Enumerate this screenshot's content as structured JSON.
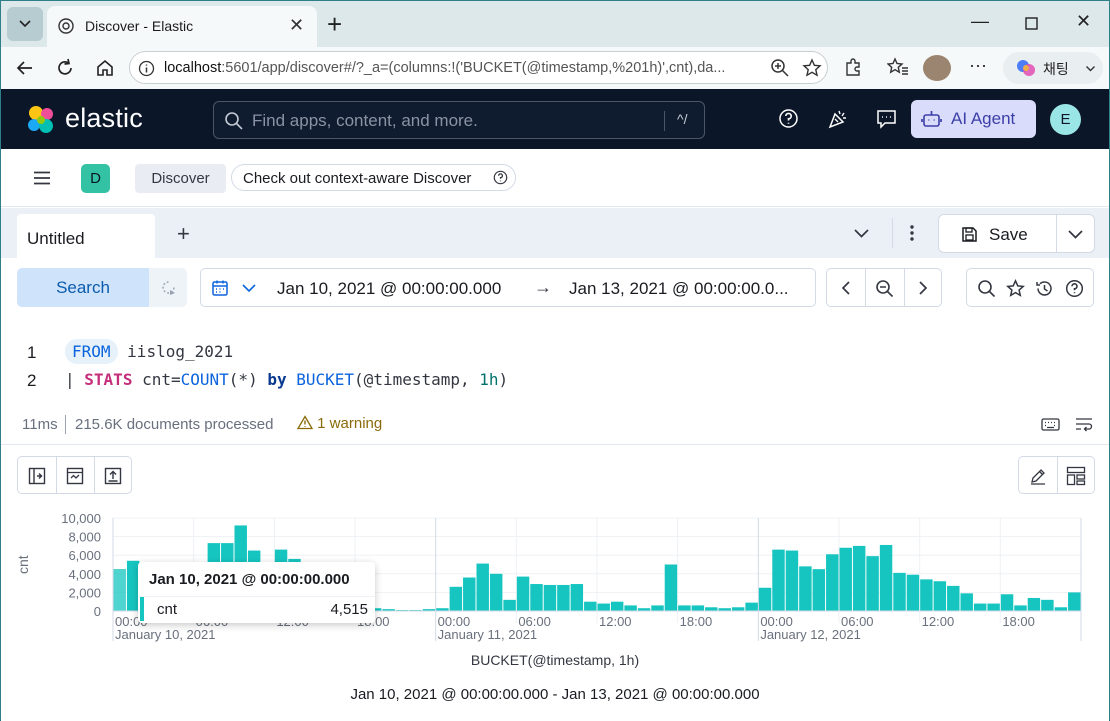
{
  "browser": {
    "tab_title": "Discover - Elastic",
    "url_host": "localhost",
    "url_rest": ":5601/app/discover#/?_a=(columns:!('BUCKET(@timestamp,%201h)',cnt),da...",
    "chat_label": "채팅"
  },
  "header": {
    "brand": "elastic",
    "search_placeholder": "Find apps, content, and more.",
    "search_shortcut": "^/",
    "ai_agent_label": "AI Agent",
    "avatar_initial": "E"
  },
  "breadcrumbs": {
    "space_initial": "D",
    "current": "Discover",
    "context_aware": "Check out context-aware Discover"
  },
  "tabs": {
    "active": "Untitled",
    "save_label": "Save"
  },
  "query_bar": {
    "search_label": "Search",
    "date_start": "Jan 10, 2021 @ 00:00:00.000",
    "date_end": "Jan 13, 2021 @ 00:00:00.0...",
    "arrow": "→"
  },
  "editor": {
    "line1_no": "1",
    "line2_no": "2",
    "from": "FROM",
    "index": "iislog_2021",
    "pipe": "|",
    "stats": "STATS",
    "assign": "cnt=",
    "count_fn": "COUNT",
    "count_arg": "(*)",
    "by": "by",
    "bucket_fn": "BUCKET",
    "bucket_arg": "(@timestamp, ",
    "bucket_interval": "1h",
    "close": ")"
  },
  "status": {
    "duration": "11ms",
    "docs": "215.6K documents processed",
    "warning": "1 warning"
  },
  "chart": {
    "ylabel": "cnt",
    "xlabel": "BUCKET(@timestamp, 1h)",
    "range": "Jan 10, 2021 @ 00:00:00.000 - Jan 13, 2021 @ 00:00:00.000",
    "tooltip_title": "Jan 10, 2021 @ 00:00:00.000",
    "tooltip_key": "cnt",
    "tooltip_value": "4,515",
    "bar_color": "#16c5c0"
  },
  "chart_data": {
    "type": "bar",
    "title": "",
    "xlabel": "BUCKET(@timestamp, 1h)",
    "ylabel": "cnt",
    "ylim": [
      0,
      10000
    ],
    "y_ticks": [
      "0",
      "2,000",
      "4,000",
      "6,000",
      "8,000",
      "10,000"
    ],
    "x_ticks": [
      "00:00",
      "06:00",
      "12:00",
      "18:00",
      "00:00",
      "06:00",
      "12:00",
      "18:00",
      "00:00",
      "06:00",
      "12:00",
      "18:00"
    ],
    "x_day_labels": [
      "January 10, 2021",
      "January 11, 2021",
      "January 12, 2021"
    ],
    "x_start": "2021-01-10T00:00",
    "interval": "1h",
    "series": [
      {
        "name": "cnt",
        "values": [
          4515,
          5400,
          3200,
          3100,
          2900,
          3000,
          4300,
          7300,
          7300,
          9200,
          6500,
          4300,
          6600,
          5600,
          2700,
          2000,
          1500,
          1200,
          600,
          300,
          200,
          100,
          100,
          200,
          300,
          2600,
          3600,
          5100,
          4000,
          1200,
          3700,
          2900,
          2800,
          2800,
          2900,
          1000,
          800,
          1000,
          600,
          300,
          600,
          5000,
          600,
          600,
          400,
          300,
          400,
          900,
          2500,
          6600,
          6500,
          4800,
          4500,
          6100,
          6800,
          7000,
          5900,
          7100,
          4100,
          3900,
          3400,
          3200,
          2700,
          1900,
          800,
          800,
          1800,
          600,
          1400,
          1200,
          400,
          2000
        ]
      }
    ]
  }
}
